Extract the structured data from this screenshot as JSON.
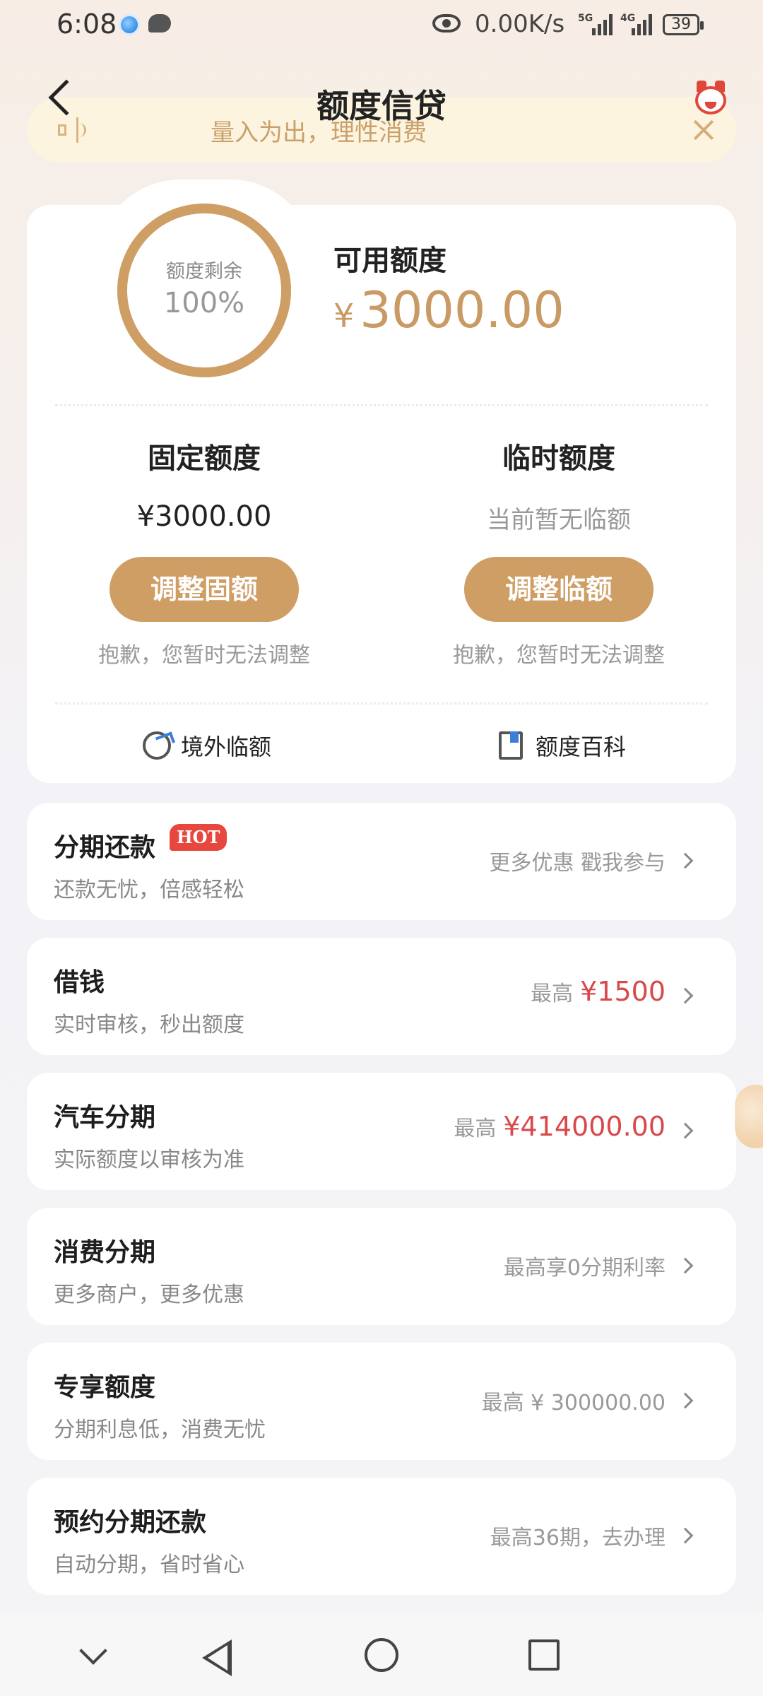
{
  "status_bar": {
    "time": "6:08",
    "speed": "0.00K/s",
    "net1": "5G",
    "net2": "4G",
    "battery": "39"
  },
  "header": {
    "title": "额度信贷"
  },
  "notice": {
    "text": "量入为出，理性消费"
  },
  "credit": {
    "ring_label": "额度剩余",
    "ring_value": "100%",
    "ring_fraction": 1.0,
    "available_label": "可用额度",
    "currency": "¥",
    "available_amount": "3000.00",
    "fixed": {
      "title": "固定额度",
      "value": "¥3000.00",
      "button": "调整固额",
      "note": "抱歉，您暂时无法调整"
    },
    "temp": {
      "title": "临时额度",
      "value": "当前暂无临额",
      "button": "调整临额",
      "note": "抱歉，您暂时无法调整"
    },
    "links": {
      "overseas": "境外临额",
      "wiki": "额度百科"
    }
  },
  "items": [
    {
      "title": "分期还款",
      "badge": "HOT",
      "sub": "还款无忧，倍感轻松",
      "right_prefix": "更多优惠 戳我参与",
      "right_value": ""
    },
    {
      "title": "借钱",
      "sub": "实时审核，秒出额度",
      "right_prefix": "最高",
      "right_value": "¥1500"
    },
    {
      "title": "汽车分期",
      "sub": "实际额度以审核为准",
      "right_prefix": "最高",
      "right_value": "¥414000.00"
    },
    {
      "title": "消费分期",
      "sub": "更多商户，更多优惠",
      "right_prefix": "最高享0分期利率",
      "right_value": ""
    },
    {
      "title": "专享额度",
      "sub": "分期利息低，消费无忧",
      "right_prefix": "最高 ¥ 300000.00",
      "right_value": ""
    },
    {
      "title": "预约分期还款",
      "sub": "自动分期，省时省心",
      "right_prefix": "最高36期，去办理",
      "right_value": ""
    }
  ],
  "colors": {
    "accent": "#cf9e64",
    "highlight_red": "#d9484a",
    "hot_badge": "#e8473d"
  }
}
